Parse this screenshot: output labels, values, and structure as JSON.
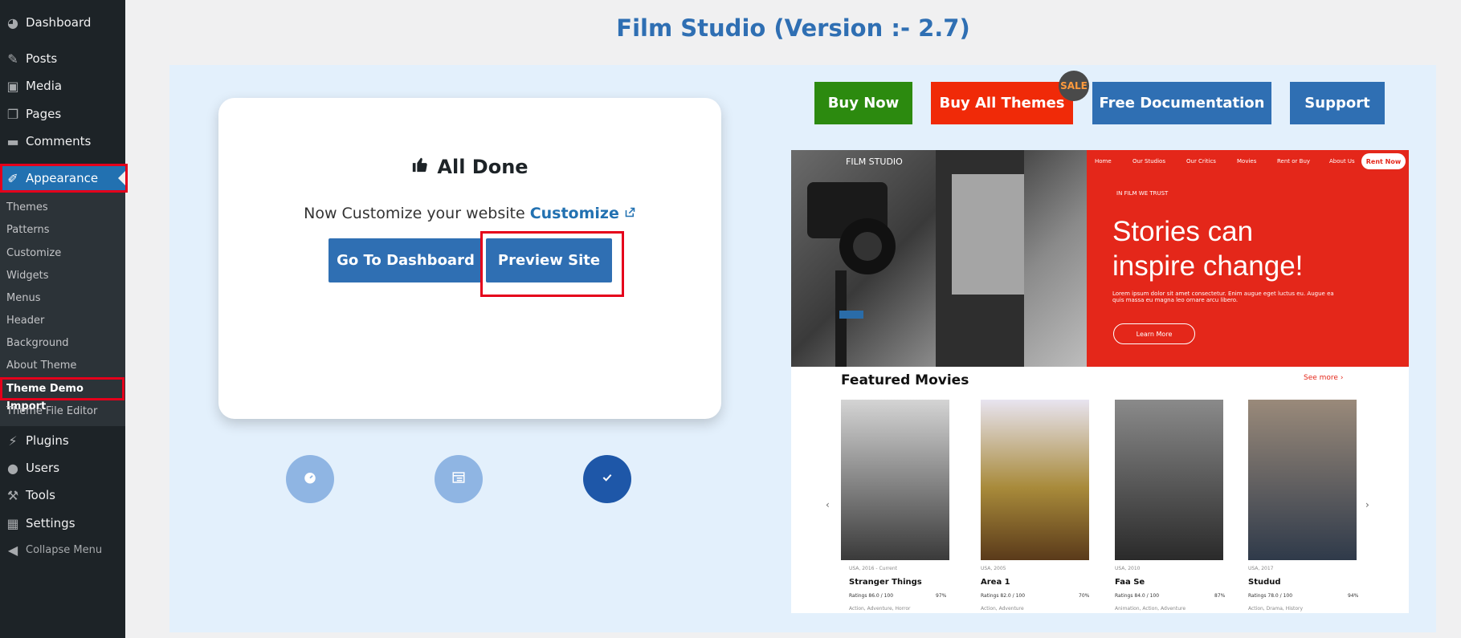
{
  "sidebar": {
    "menu": [
      {
        "label": "Dashboard",
        "icon": "dashboard-icon",
        "glyph": "◕"
      },
      {
        "label": "Posts",
        "icon": "pin-icon",
        "glyph": "✎"
      },
      {
        "label": "Media",
        "icon": "media-icon",
        "glyph": "▣"
      },
      {
        "label": "Pages",
        "icon": "pages-icon",
        "glyph": "❐"
      },
      {
        "label": "Comments",
        "icon": "comment-icon",
        "glyph": "▬"
      },
      {
        "label": "Appearance",
        "icon": "brush-icon",
        "glyph": "✐"
      }
    ],
    "submenu": [
      "Themes",
      "Patterns",
      "Customize",
      "Widgets",
      "Menus",
      "Header",
      "Background",
      "About Theme",
      "Theme Demo Import",
      "Theme File Editor"
    ],
    "menu_bottom": [
      {
        "label": "Plugins",
        "icon": "plugin-icon",
        "glyph": "⚡"
      },
      {
        "label": "Users",
        "icon": "user-icon",
        "glyph": "●"
      },
      {
        "label": "Tools",
        "icon": "wrench-icon",
        "glyph": "⚒"
      },
      {
        "label": "Settings",
        "icon": "settings-icon",
        "glyph": "▦"
      },
      {
        "label": "Collapse Menu",
        "icon": "collapse-icon",
        "glyph": "◀"
      }
    ]
  },
  "header": {
    "title": "Film Studio (Version :- 2.7)"
  },
  "card": {
    "title": "All Done",
    "subtitle": "Now Customize your website",
    "customize_link": "Customize",
    "dashboard_btn": "Go To Dashboard",
    "preview_btn": "Preview Site"
  },
  "top_buttons": {
    "buy_now": "Buy Now",
    "buy_all": "Buy All Themes",
    "sale": "SALE",
    "docs": "Free Documentation",
    "support": "Support"
  },
  "preview": {
    "brand": "FILM STUDIO",
    "nav": [
      "Home",
      "Our Studios",
      "Our Critics",
      "Movies",
      "Rent or Buy",
      "About Us"
    ],
    "rent_now": "Rent Now",
    "tagline": "IN FILM WE TRUST",
    "hero_title": "Stories can inspire change!",
    "hero_text": "Lorem ipsum dolor sit amet consectetur. Enim augue eget luctus eu. Augue ea quis massa eu magna leo ornare arcu libero.",
    "learn_more": "Learn More",
    "featured": "Featured Movies",
    "see_more": "See more",
    "movies": [
      {
        "meta": "USA, 2016 - Current",
        "title": "Stranger Things",
        "ratings": "Ratings 86.0 / 100",
        "pct": "97%",
        "genre": "Action, Adventure, Horror"
      },
      {
        "meta": "USA, 2005",
        "title": "Area 1",
        "ratings": "Ratings 82.0 / 100",
        "pct": "70%",
        "genre": "Action, Adventure"
      },
      {
        "meta": "USA, 2010",
        "title": "Faa Se",
        "ratings": "Ratings 84.0 / 100",
        "pct": "87%",
        "genre": "Animation, Action, Adventure"
      },
      {
        "meta": "USA, 2017",
        "title": "Studud",
        "ratings": "Ratings 78.0 / 100",
        "pct": "94%",
        "genre": "Action, Drama, History"
      }
    ]
  },
  "colors": {
    "green": "#2c8a0f",
    "red": "#f02a08",
    "blue": "#2f6fb3",
    "hero_red": "#e4271a"
  }
}
